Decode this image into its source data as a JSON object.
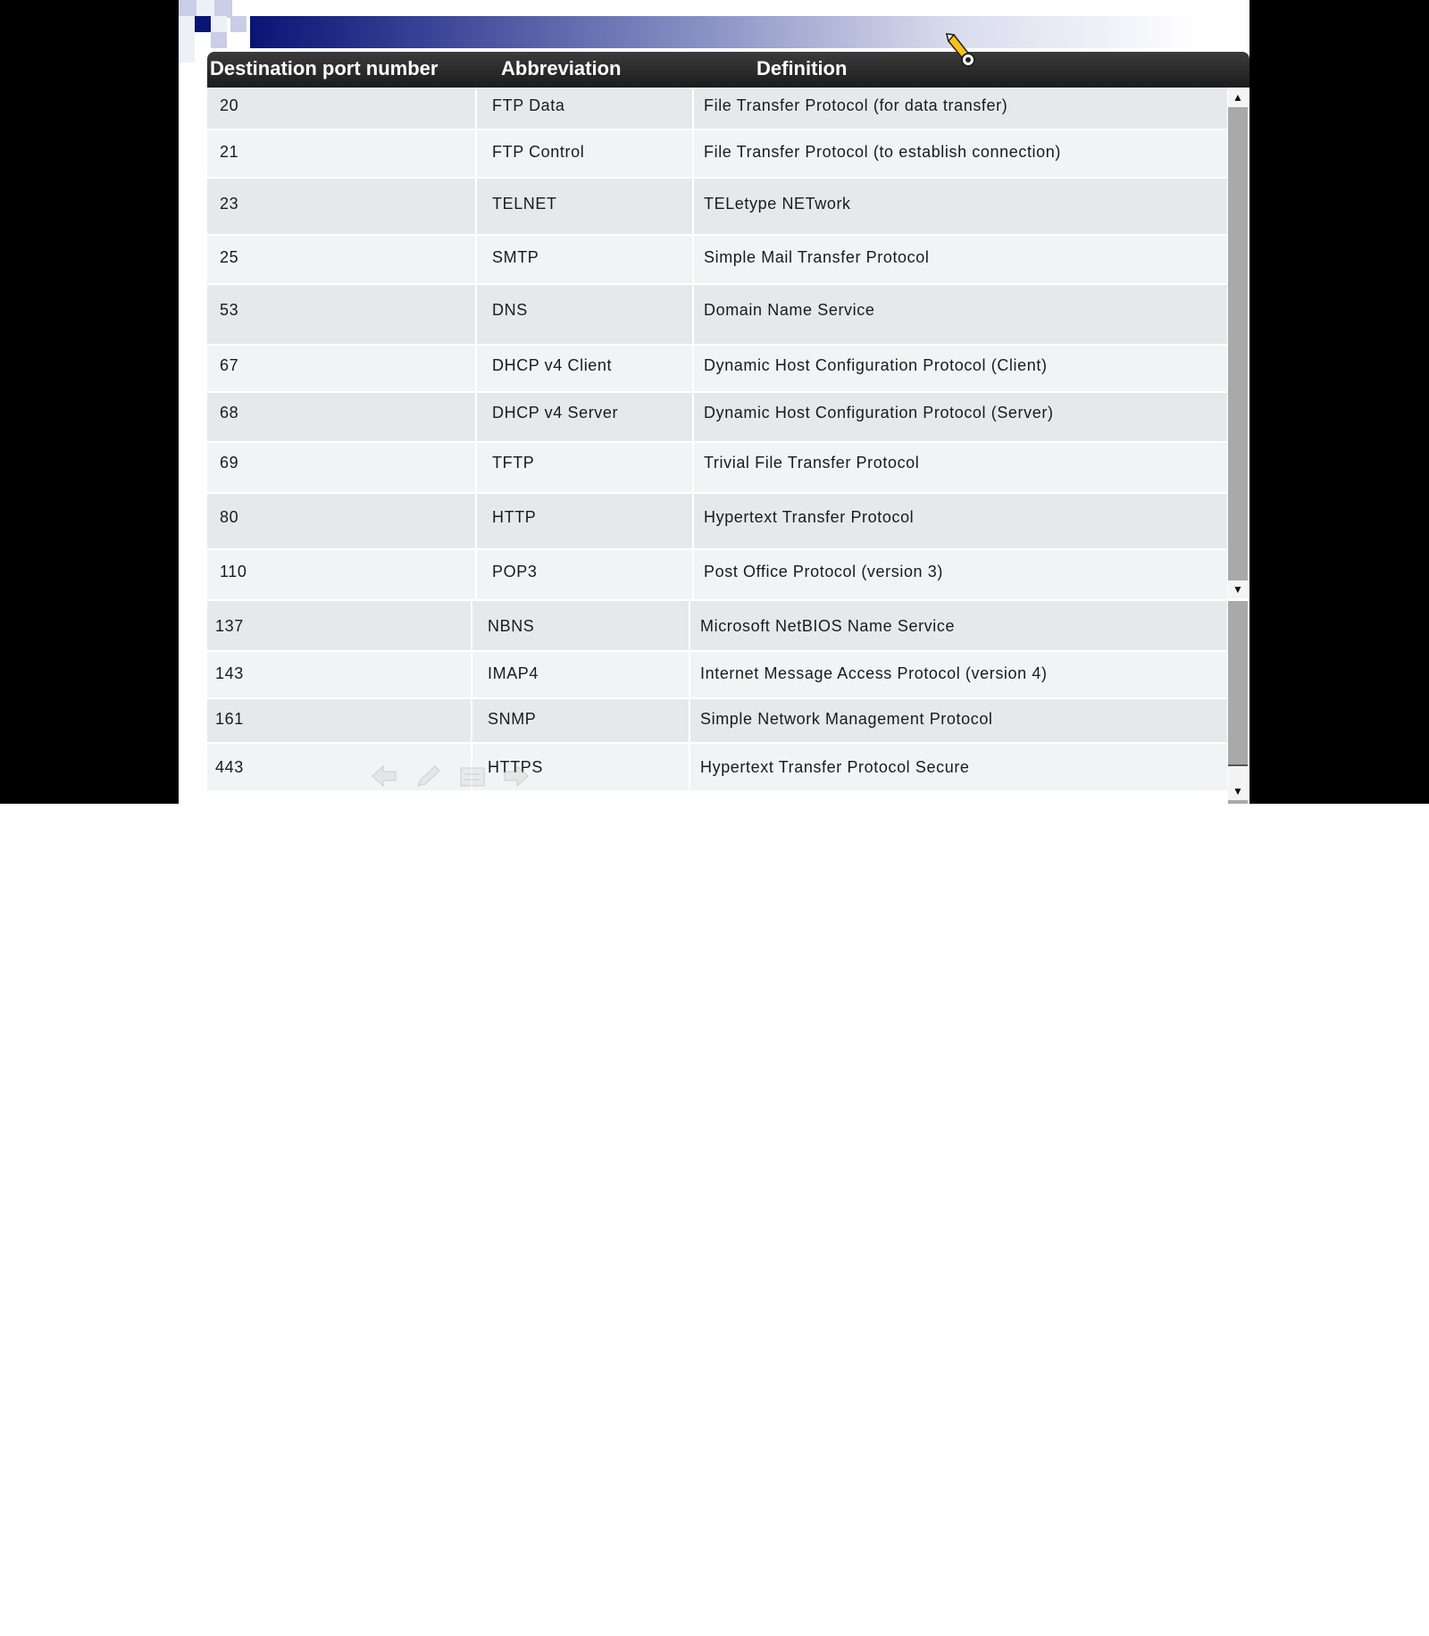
{
  "table": {
    "headers": [
      "Destination port number",
      "Abbreviation",
      "Definition"
    ],
    "rows": [
      {
        "port": "20",
        "abbr": "FTP Data",
        "definition": "File Transfer Protocol (for data transfer)"
      },
      {
        "port": "21",
        "abbr": "FTP Control",
        "definition": "File Transfer Protocol (to establish connection)"
      },
      {
        "port": "23",
        "abbr": "TELNET",
        "definition": "TELetype NETwork"
      },
      {
        "port": "25",
        "abbr": "SMTP",
        "definition": "Simple Mail Transfer Protocol"
      },
      {
        "port": "53",
        "abbr": "DNS",
        "definition": "Domain Name Service"
      },
      {
        "port": "67",
        "abbr": "DHCP v4 Client",
        "definition": "Dynamic Host Configuration Protocol (Client)"
      },
      {
        "port": "68",
        "abbr": "DHCP v4 Server",
        "definition": "Dynamic Host Configuration Protocol (Server)"
      },
      {
        "port": "69",
        "abbr": "TFTP",
        "definition": "Trivial File Transfer Protocol"
      },
      {
        "port": "80",
        "abbr": "HTTP",
        "definition": "Hypertext Transfer Protocol"
      },
      {
        "port": "110",
        "abbr": "POP3",
        "definition": "Post Office Protocol (version 3)"
      },
      {
        "port": "137",
        "abbr": "NBNS",
        "definition": "Microsoft NetBIOS Name Service"
      },
      {
        "port": "143",
        "abbr": "IMAP4",
        "definition": "Internet Message Access Protocol (version 4)"
      },
      {
        "port": "161",
        "abbr": "SNMP",
        "definition": "Simple Network Management Protocol"
      },
      {
        "port": "443",
        "abbr": "HTTPS",
        "definition": "Hypertext Transfer Protocol Secure"
      }
    ]
  },
  "icons": {
    "scroll_up": "arrow-up-icon",
    "scroll_down": "arrow-down-icon",
    "nav_prev": "arrow-left-icon",
    "nav_pen": "pen-icon",
    "nav_menu": "menu-icon",
    "nav_next": "arrow-right-icon",
    "cursor": "pen-cursor-icon"
  },
  "colors": {
    "title_band_start": "#0a1475",
    "header_bg": "#2a2a2a",
    "row_odd": "#e6e9ec",
    "row_even": "#f1f3f4",
    "scrollbar": "#a9a9a9"
  }
}
